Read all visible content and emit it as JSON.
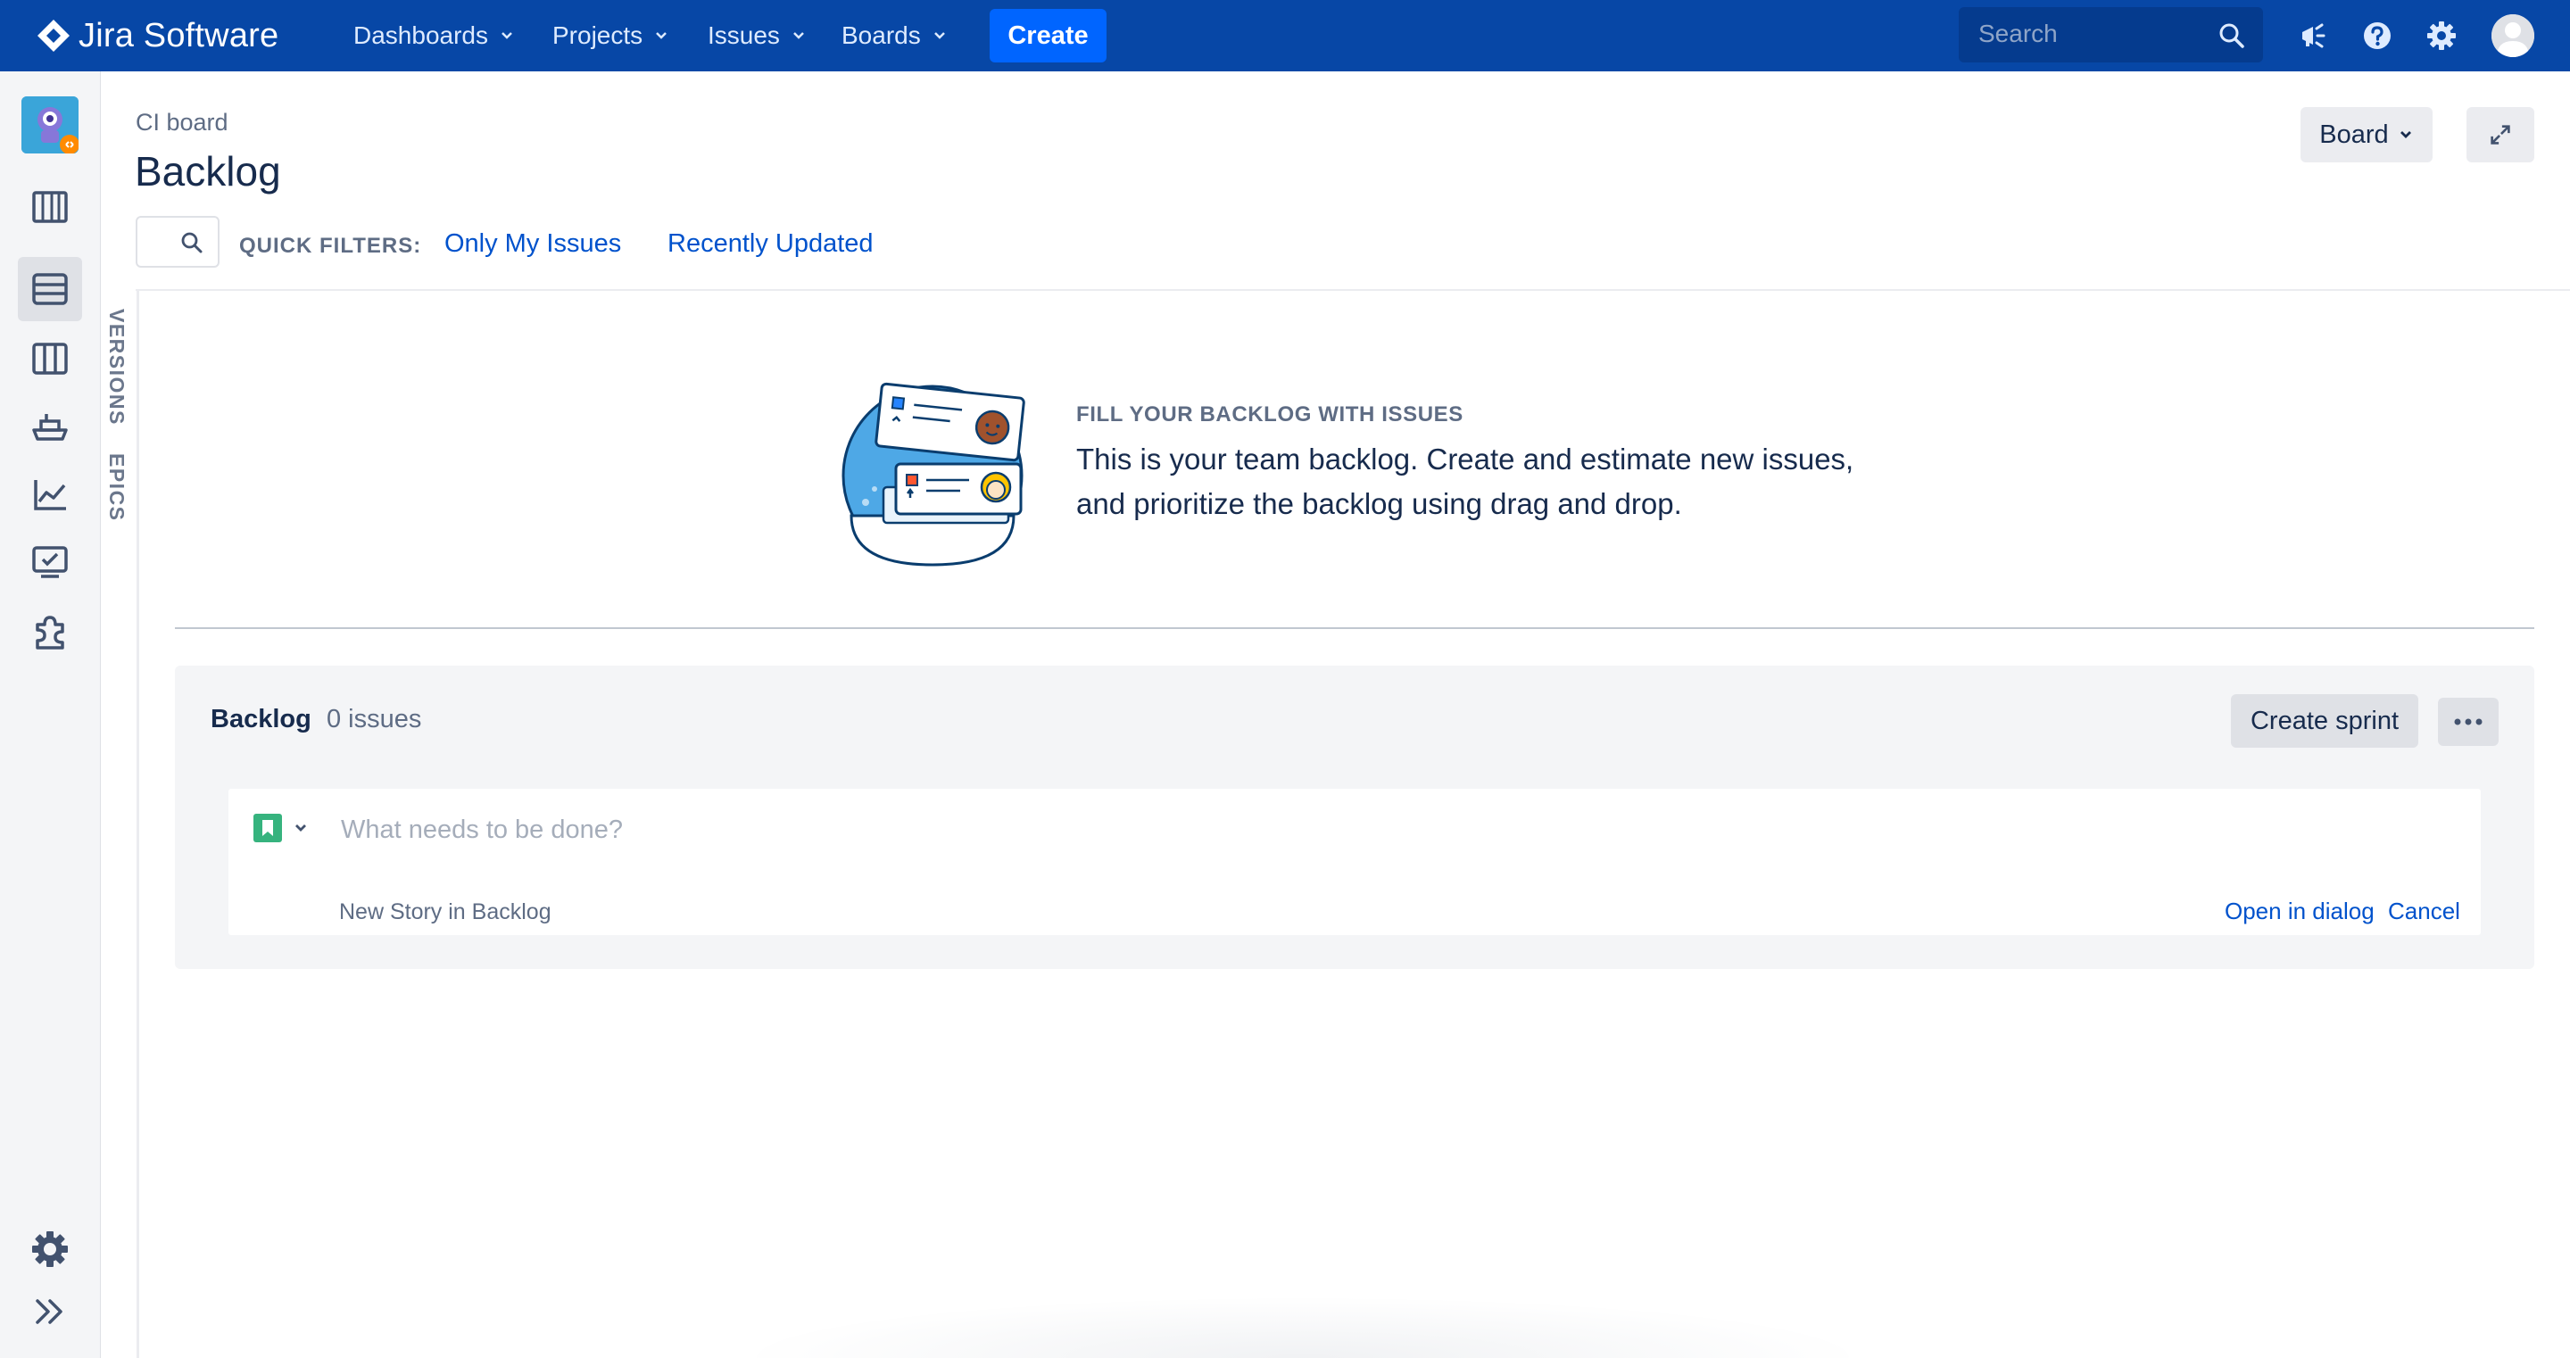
{
  "nav": {
    "app_name": "Jira Software",
    "menu": [
      {
        "label": "Dashboards"
      },
      {
        "label": "Projects"
      },
      {
        "label": "Issues"
      },
      {
        "label": "Boards"
      }
    ],
    "create_label": "Create",
    "search_placeholder": "Search",
    "icons": [
      "megaphone-icon",
      "help-icon",
      "settings-icon",
      "avatar"
    ]
  },
  "sidebar": {
    "icons": [
      "roadmap-icon",
      "backlog-icon",
      "board-icon",
      "releases-icon",
      "reports-icon",
      "issues-icon",
      "addons-icon",
      "project-settings-icon",
      "expand-sidebar-icon"
    ],
    "active": "backlog-icon"
  },
  "side_tabs": {
    "versions": "VERSIONS",
    "epics": "EPICS"
  },
  "header": {
    "breadcrumb": "CI board",
    "title": "Backlog",
    "board_button": "Board",
    "quick_filters_label": "QUICK FILTERS:",
    "quick_filters": [
      "Only My Issues",
      "Recently Updated"
    ]
  },
  "empty_state": {
    "heading": "FILL YOUR BACKLOG WITH ISSUES",
    "body": "This is your team backlog. Create and estimate new issues, and prioritize the backlog using drag and drop."
  },
  "backlog": {
    "title": "Backlog",
    "count": "0 issues",
    "create_sprint": "Create sprint",
    "inline_create": {
      "placeholder": "What needs to be done?",
      "hint": "New Story in Backlog",
      "open_dialog": "Open in dialog",
      "cancel": "Cancel",
      "issue_type": "story"
    }
  },
  "colors": {
    "nav_bg": "#0747a6",
    "primary": "#0052cc",
    "create_btn": "#0065ff",
    "story_green": "#36b37e"
  }
}
